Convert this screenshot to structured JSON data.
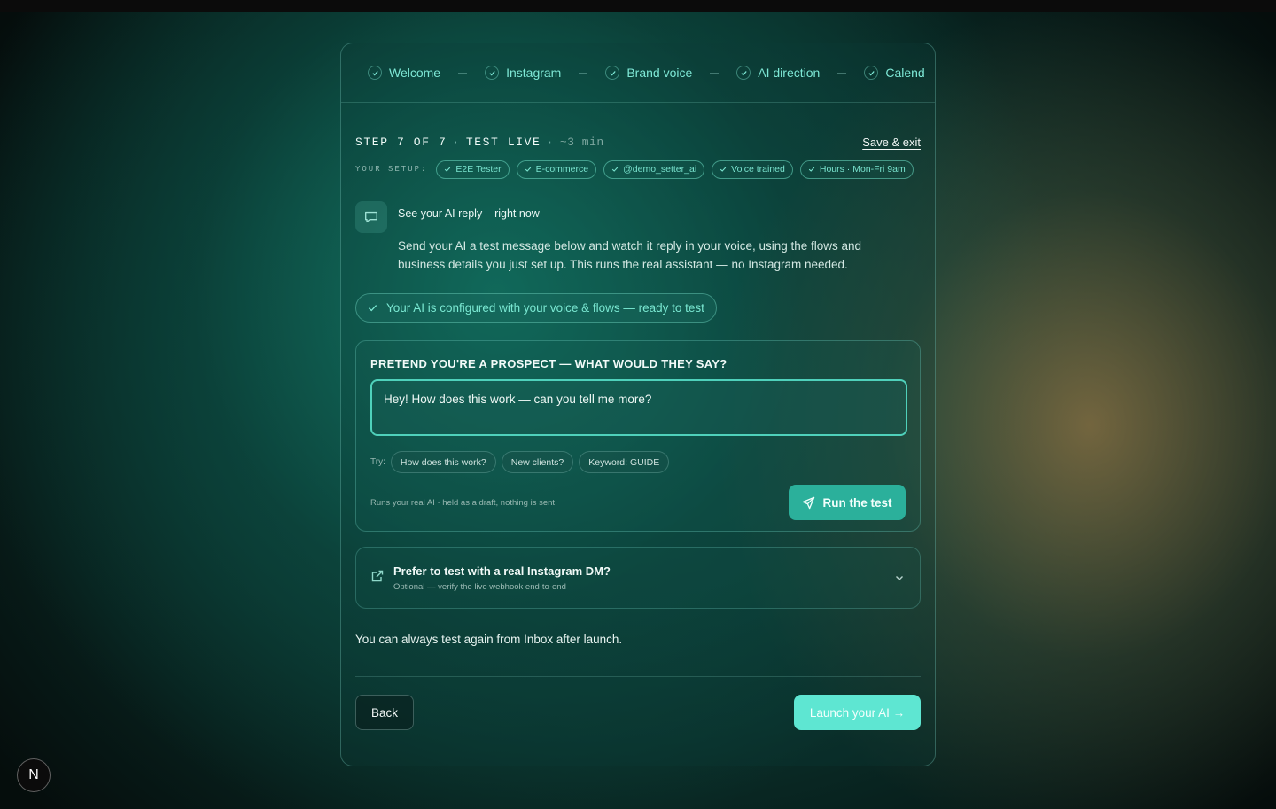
{
  "stepper": {
    "steps": [
      {
        "label": "Welcome"
      },
      {
        "label": "Instagram"
      },
      {
        "label": "Brand voice"
      },
      {
        "label": "AI direction"
      },
      {
        "label": "Calend"
      }
    ]
  },
  "header": {
    "step_label": "STEP 7 OF 7",
    "step_name": "TEST LIVE",
    "time": "~3 min",
    "save_exit": "Save & exit"
  },
  "setup": {
    "label": "YOUR SETUP:",
    "chips": [
      "E2E Tester",
      "E-commerce",
      "@demo_setter_ai",
      "Voice trained",
      "Hours · Mon-Fri 9am"
    ]
  },
  "intro": {
    "title": "See your AI reply – right now",
    "description": "Send your AI a test message below and watch it reply in your voice, using the flows and business details you just set up. This runs the real assistant — no Instagram needed."
  },
  "status": {
    "ready_text": "Your AI is configured with your voice & flows — ready to test"
  },
  "prospect": {
    "heading": "PRETEND YOU'RE A PROSPECT — WHAT WOULD THEY SAY?",
    "message_value": "Hey! How does this work — can you tell me more?",
    "try_label": "Try:",
    "suggestions": [
      "How does this work?",
      "New clients?",
      "Keyword: GUIDE"
    ],
    "run_note": "Runs your real AI · held as a draft, nothing is sent",
    "run_label": "Run the test"
  },
  "dm": {
    "title": "Prefer to test with a real Instagram DM?",
    "subtitle": "Optional — verify the live webhook end-to-end"
  },
  "footer": {
    "always_text": "You can always test again from Inbox after launch.",
    "back_label": "Back",
    "launch_label": "Launch your AI →"
  },
  "badge": {
    "letter": "N"
  },
  "colors": {
    "accent": "#2bb09b",
    "accent_light": "#5ee6d2",
    "text_accent": "#7ae4cf"
  }
}
